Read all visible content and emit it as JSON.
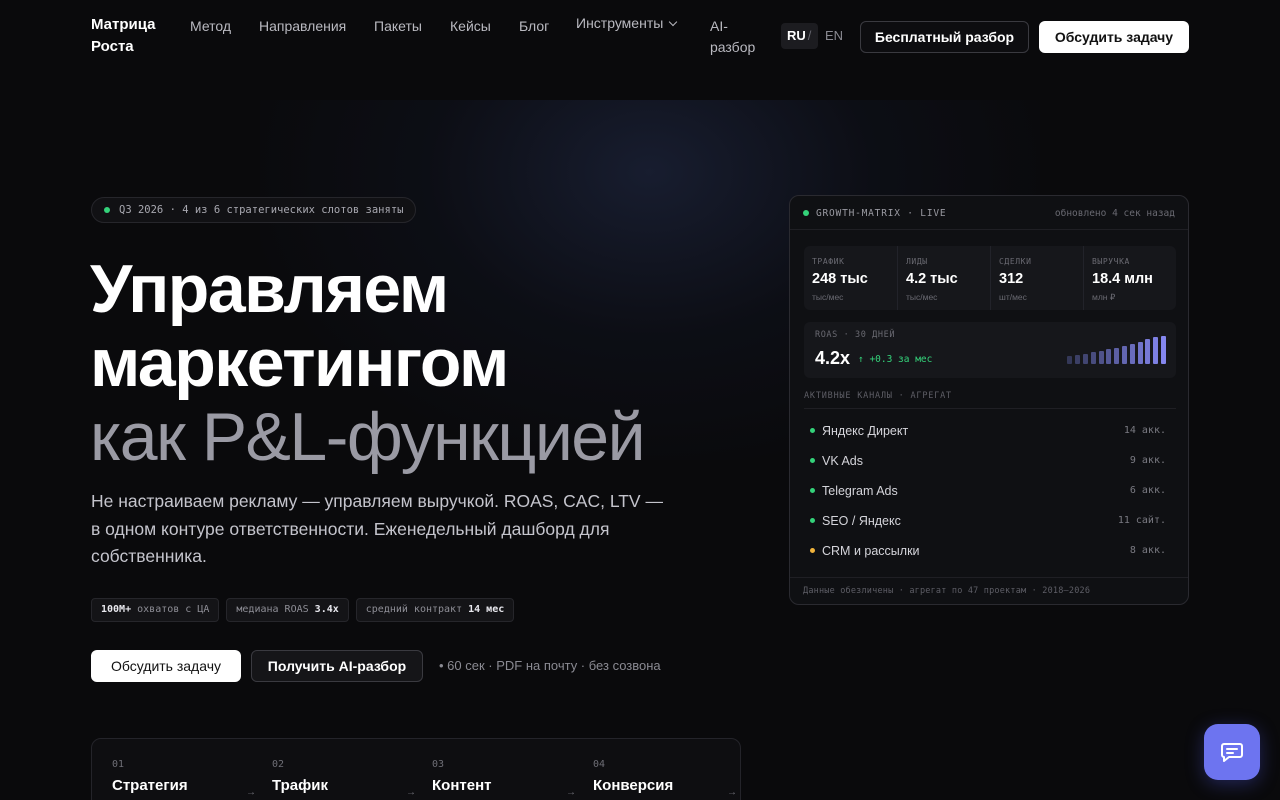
{
  "nav": {
    "brand": "Матрица Роста",
    "links": [
      "Метод",
      "Направления",
      "Пакеты",
      "Кейсы",
      "Блог"
    ],
    "tools": "Инструменты",
    "ai": "AI-разбор",
    "lang_ru": "RU",
    "lang_sep": "/",
    "lang_en": "EN",
    "free_btn": "Бесплатный разбор",
    "discuss_btn": "Обсудить задачу"
  },
  "hero": {
    "pill": "Q3 2026 · 4 из 6 стратегических слотов заняты",
    "title_l1": "Управляем",
    "title_l2": "маркетингом",
    "title_l3": "как P&L-функцией",
    "lead": "Не настраиваем рекламу — управляем выручкой. ROAS, CAC, LTV — в одном контуре ответственности. Еженедельный дашборд для собственника.",
    "tags": [
      {
        "strong": "100М+",
        "text": " охватов с ЦА"
      },
      {
        "text": "медиана ROAS ",
        "strong": "3.4x"
      },
      {
        "text": "средний контракт ",
        "strong": "14 мес"
      }
    ],
    "cta_primary": "Обсудить задачу",
    "cta_secondary": "Получить AI-разбор",
    "cta_note": "• 60 сек · PDF на почту · без созвона"
  },
  "steps": [
    {
      "num": "01",
      "name": "Стратегия"
    },
    {
      "num": "02",
      "name": "Трафик"
    },
    {
      "num": "03",
      "name": "Контент"
    },
    {
      "num": "04",
      "name": "Конверсия"
    }
  ],
  "dashboard": {
    "title": "GROWTH-MATRIX · LIVE",
    "updated": "обновлено 4 сек назад",
    "kpis": [
      {
        "label": "Трафик",
        "value": "248 тыс",
        "unit": "тыс/мес"
      },
      {
        "label": "Лиды",
        "value": "4.2 тыс",
        "unit": "тыс/мес"
      },
      {
        "label": "Сделки",
        "value": "312",
        "unit": "шт/мес"
      },
      {
        "label": "Выручка",
        "value": "18.4 млн",
        "unit": "млн ₽"
      }
    ],
    "roas_label": "ROAS · 30 ДНЕЙ",
    "roas_value": "4.2x",
    "roas_delta": "↑ +0.3 за мес",
    "roas_bars": [
      0.28,
      0.32,
      0.36,
      0.42,
      0.48,
      0.52,
      0.58,
      0.64,
      0.72,
      0.78,
      0.88,
      0.95,
      1.0
    ],
    "channels_head": "Активные каналы · агрегат",
    "channels": [
      {
        "name": "Яндекс Директ",
        "count": "14 акк.",
        "color": "#34d27a"
      },
      {
        "name": "VK Ads",
        "count": "9 акк.",
        "color": "#34d27a"
      },
      {
        "name": "Telegram Ads",
        "count": "6 акк.",
        "color": "#34d27a"
      },
      {
        "name": "SEO / Яндекс",
        "count": "11 сайт.",
        "color": "#34d27a"
      },
      {
        "name": "CRM и рассылки",
        "count": "8 акк.",
        "color": "#f0b33c"
      }
    ],
    "footer": "Данные обезличены · агрегат по 47 проектам · 2018–2026"
  },
  "colors": {
    "accent": "#6d74f0",
    "positive": "#34d27a",
    "warning": "#f0b33c"
  },
  "chat_icon": "chat-bubble-icon"
}
